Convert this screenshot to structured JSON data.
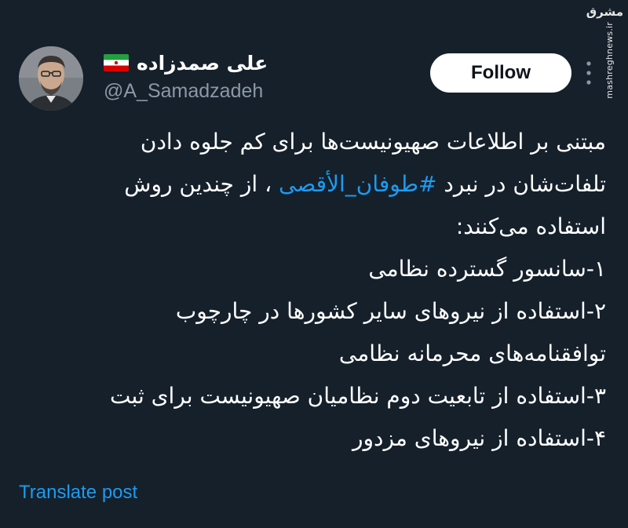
{
  "watermark": {
    "logo_text": "مشرق",
    "site": "mashreghnews.ir"
  },
  "author": {
    "display_name": "علی صمدزاده",
    "handle": "@A_Samadzadeh"
  },
  "follow_button": {
    "label": "Follow"
  },
  "tweet": {
    "line1": "مبتنی بر اطلاعات صهیونیست‌ها برای کم جلوه دادن",
    "line2_before": "تلفات‌شان در نبرد ",
    "line2_hashtag": "#طوفان_الأقصی",
    "line2_after": " ، از چندین روش",
    "line3": "استفاده می‌کنند:",
    "line4": "۱-سانسور گسترده نظامی",
    "line5": "۲-استفاده از نیروهای سایر کشورها در چارچوب",
    "line6": "توافقنامه‌های محرمانه نظامی",
    "line7": "۳-استفاده از تابعیت دوم نظامیان صهیونیست برای ثبت",
    "line8": "۴-استفاده از نیروهای مزدور"
  },
  "translate": {
    "label": "Translate post"
  },
  "colors": {
    "background": "#15202b",
    "link": "#1d9bf0",
    "secondary_text": "#8b98a5"
  },
  "icons": {
    "flag": "iran-flag-icon",
    "more": "more-vertical-icon"
  }
}
